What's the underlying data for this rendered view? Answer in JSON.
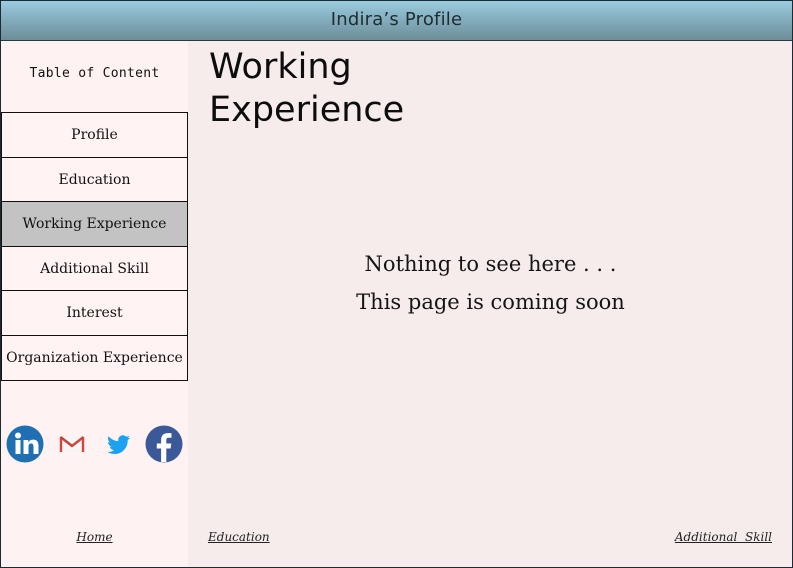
{
  "header": {
    "title": "Indira’s Profile"
  },
  "sidebar": {
    "toc_title": "Table of Content",
    "items": [
      {
        "label": "Profile",
        "active": false
      },
      {
        "label": "Education",
        "active": false
      },
      {
        "label": "Working Experience",
        "active": true
      },
      {
        "label": "Additional Skill",
        "active": false
      },
      {
        "label": "Interest",
        "active": false
      },
      {
        "label": "Organization Experience",
        "active": false
      }
    ],
    "social": [
      {
        "icon": "linkedin-icon",
        "color": "#1f6fb2"
      },
      {
        "icon": "gmail-icon",
        "color": "#c9463d"
      },
      {
        "icon": "twitter-icon",
        "color": "#1da1f2"
      },
      {
        "icon": "facebook-icon",
        "color": "#3b5998"
      }
    ],
    "home_link": "Home"
  },
  "main": {
    "heading": "Working Experience",
    "message_line1": "Nothing to see here . . .",
    "message_line2": "This page is coming soon",
    "prev_link": "Education",
    "next_link": "Additional  Skill"
  },
  "colors": {
    "header_gradient_top": "#9ccde1",
    "header_gradient_bottom": "#6f8d99",
    "sidebar_bg": "#fff2f2",
    "main_bg": "#f6ecec",
    "active_item_bg": "#c3c3c3"
  }
}
